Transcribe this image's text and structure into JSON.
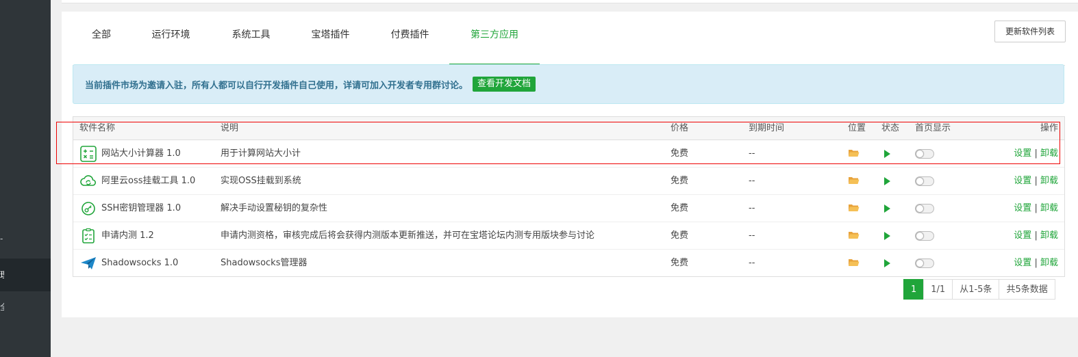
{
  "sidebar": {
    "frag1": "-",
    "frag2": "理",
    "frag3": "全"
  },
  "tabs": [
    {
      "label": "全部"
    },
    {
      "label": "运行环境"
    },
    {
      "label": "系统工具"
    },
    {
      "label": "宝塔插件"
    },
    {
      "label": "付费插件"
    },
    {
      "label": "第三方应用"
    }
  ],
  "active_tab": "第三方应用",
  "refresh_label": "更新软件列表",
  "notice": {
    "text": "当前插件市场为邀请入驻，所有人都可以自行开发插件自己使用，详请可加入开发者专用群讨论。",
    "button": "查看开发文档"
  },
  "table": {
    "headers": {
      "name": "软件名称",
      "desc": "说明",
      "price": "价格",
      "expire": "到期时间",
      "location": "位置",
      "status": "状态",
      "home": "首页显示",
      "ops": "操作"
    },
    "rows": [
      {
        "icon": "calculator-icon",
        "name": "网站大小计算器 1.0",
        "desc": "用于计算网站大小计",
        "price": "免费",
        "expire": "--",
        "op_set": "设置",
        "op_sep": "|",
        "op_uninstall": "卸载"
      },
      {
        "icon": "cloud-sync-icon",
        "name": "阿里云oss挂载工具 1.0",
        "desc": "实现OSS挂载到系统",
        "price": "免费",
        "expire": "--",
        "op_set": "设置",
        "op_sep": "|",
        "op_uninstall": "卸载"
      },
      {
        "icon": "key-icon",
        "name": "SSH密钥管理器 1.0",
        "desc": "解决手动设置秘钥的复杂性",
        "price": "免费",
        "expire": "--",
        "op_set": "设置",
        "op_sep": "|",
        "op_uninstall": "卸载"
      },
      {
        "icon": "clipboard-check-icon",
        "name": "申请内测 1.2",
        "desc": "申请内测资格，审核完成后将会获得内测版本更新推送，并可在宝塔论坛内测专用版块参与讨论",
        "price": "免费",
        "expire": "--",
        "op_set": "设置",
        "op_sep": "|",
        "op_uninstall": "卸载"
      },
      {
        "icon": "paper-plane-icon",
        "name": "Shadowsocks 1.0",
        "desc": "Shadowsocks管理器",
        "price": "免费",
        "expire": "--",
        "op_set": "设置",
        "op_sep": "|",
        "op_uninstall": "卸载"
      }
    ]
  },
  "pagination": {
    "current": "1",
    "pages": "1/1",
    "range": "从1-5条",
    "total": "共5条数据"
  },
  "colors": {
    "accent": "#20a53a",
    "notice_bg": "#d9edf7",
    "notice_text": "#31708f",
    "folder": "#f0ad4e",
    "highlight": "#ee0000",
    "sidebar": "#2f3539"
  }
}
